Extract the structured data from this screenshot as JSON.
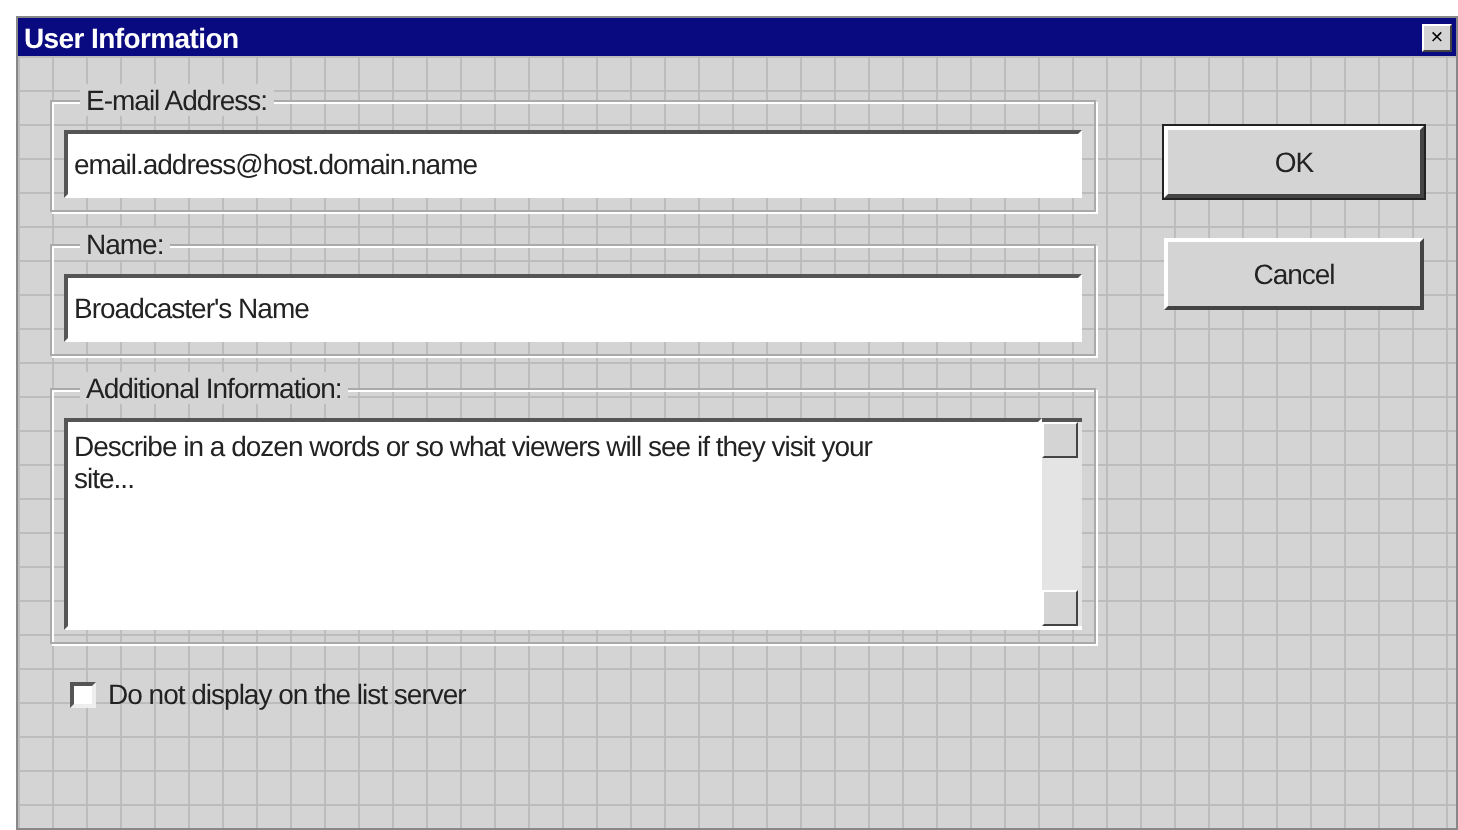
{
  "window": {
    "title": "User Information",
    "close": "×"
  },
  "fields": [
    {
      "kind": "line",
      "label": "E-mail Address:",
      "value": "email.address@host.domain.name"
    },
    {
      "kind": "line",
      "label": "Name:",
      "value": "Broadcaster's Name"
    },
    {
      "kind": "area",
      "label": "Additional Information:",
      "value": "Describe in a dozen words or so what viewers will see if they visit your site..."
    }
  ],
  "checkbox": {
    "label": "Do not display on the list server",
    "checked": false
  },
  "buttons": [
    "OK",
    "Cancel"
  ]
}
